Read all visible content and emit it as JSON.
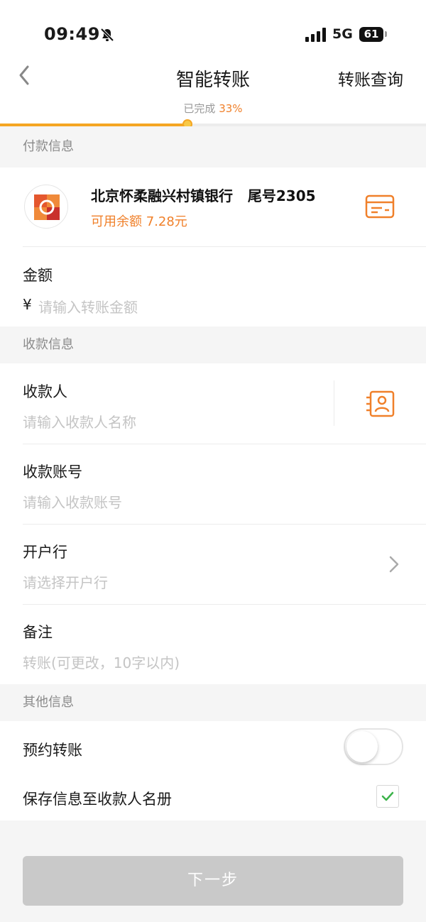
{
  "status_bar": {
    "time": "09:49",
    "network": "5G",
    "battery": "61",
    "icons": [
      "bell-slash-icon",
      "signal-icon"
    ]
  },
  "nav": {
    "title": "智能转账",
    "right_link": "转账查询",
    "progress_label": "已完成",
    "progress_value": "33%",
    "progress_fraction": 0.33
  },
  "payment_section": {
    "header": "付款信息",
    "bank_name": "北京怀柔融兴村镇银行   尾号2305",
    "balance": "可用余额 7.28元",
    "amount_label": "金额",
    "currency_symbol": "¥",
    "amount_placeholder": "请输入转账金额"
  },
  "payee_section": {
    "header": "收款信息",
    "payee_label": "收款人",
    "payee_placeholder": "请输入收款人名称",
    "account_label": "收款账号",
    "account_placeholder": "请输入收款账号",
    "bank_label": "开户行",
    "bank_placeholder": "请选择开户行",
    "remark_label": "备注",
    "remark_placeholder": "转账(可更改，10字以内)"
  },
  "other_section": {
    "header": "其他信息",
    "scheduled_label": "预约转账",
    "scheduled_on": false,
    "save_label": "保存信息至收款人名册",
    "save_checked": true
  },
  "footer": {
    "next_button": "下一步"
  },
  "colors": {
    "accent": "#f0802a",
    "progress": "#f5a623",
    "button_disabled": "#c9c9c9",
    "check": "#3cb34a"
  }
}
